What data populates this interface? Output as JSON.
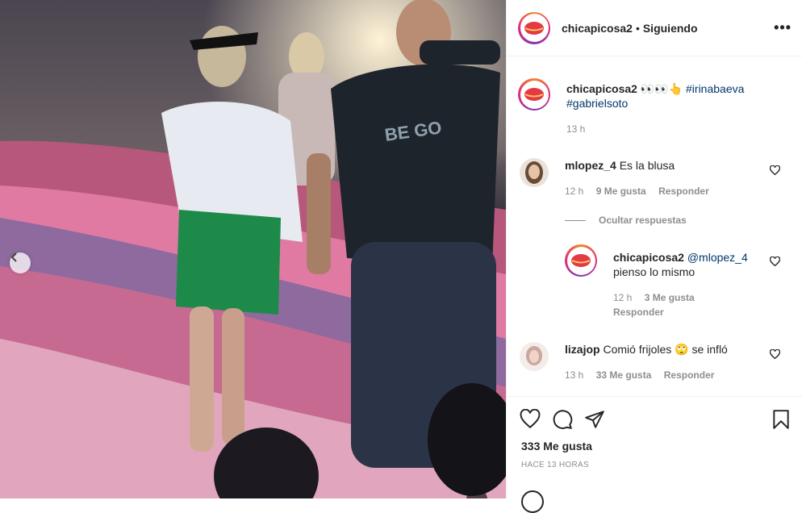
{
  "post": {
    "username": "chicapicosa2",
    "separator": "•",
    "follow_status": "Siguiendo",
    "more_icon": "more-horizontal-icon"
  },
  "caption": {
    "username": "chicapicosa2",
    "emojis": "👀👀👆",
    "hashtag1": "#irinabaeva",
    "hashtag2": "#gabrielsoto",
    "time": "13 h"
  },
  "comments": [
    {
      "username": "mlopez_4",
      "text": "Es la blusa",
      "time": "12 h",
      "likes": "9 Me gusta",
      "reply": "Responder"
    },
    {
      "username": "lizajop",
      "text_before": "Comió frijoles",
      "emoji": "🙄",
      "text_after": "se infló",
      "time": "13 h",
      "likes": "33 Me gusta",
      "reply": "Responder"
    }
  ],
  "replies_toggle": "Ocultar respuestas",
  "reply": {
    "username": "chicapicosa2",
    "mention": "@mlopez_4",
    "text": "pienso lo mismo",
    "time": "12 h",
    "likes": "3 Me gusta",
    "reply": "Responder"
  },
  "footer": {
    "likes_count": "333 Me gusta",
    "posted_ago": "HACE 13 HORAS"
  },
  "colors": {
    "link": "#00376b",
    "muted": "#8e8e8e",
    "text": "#262626"
  }
}
